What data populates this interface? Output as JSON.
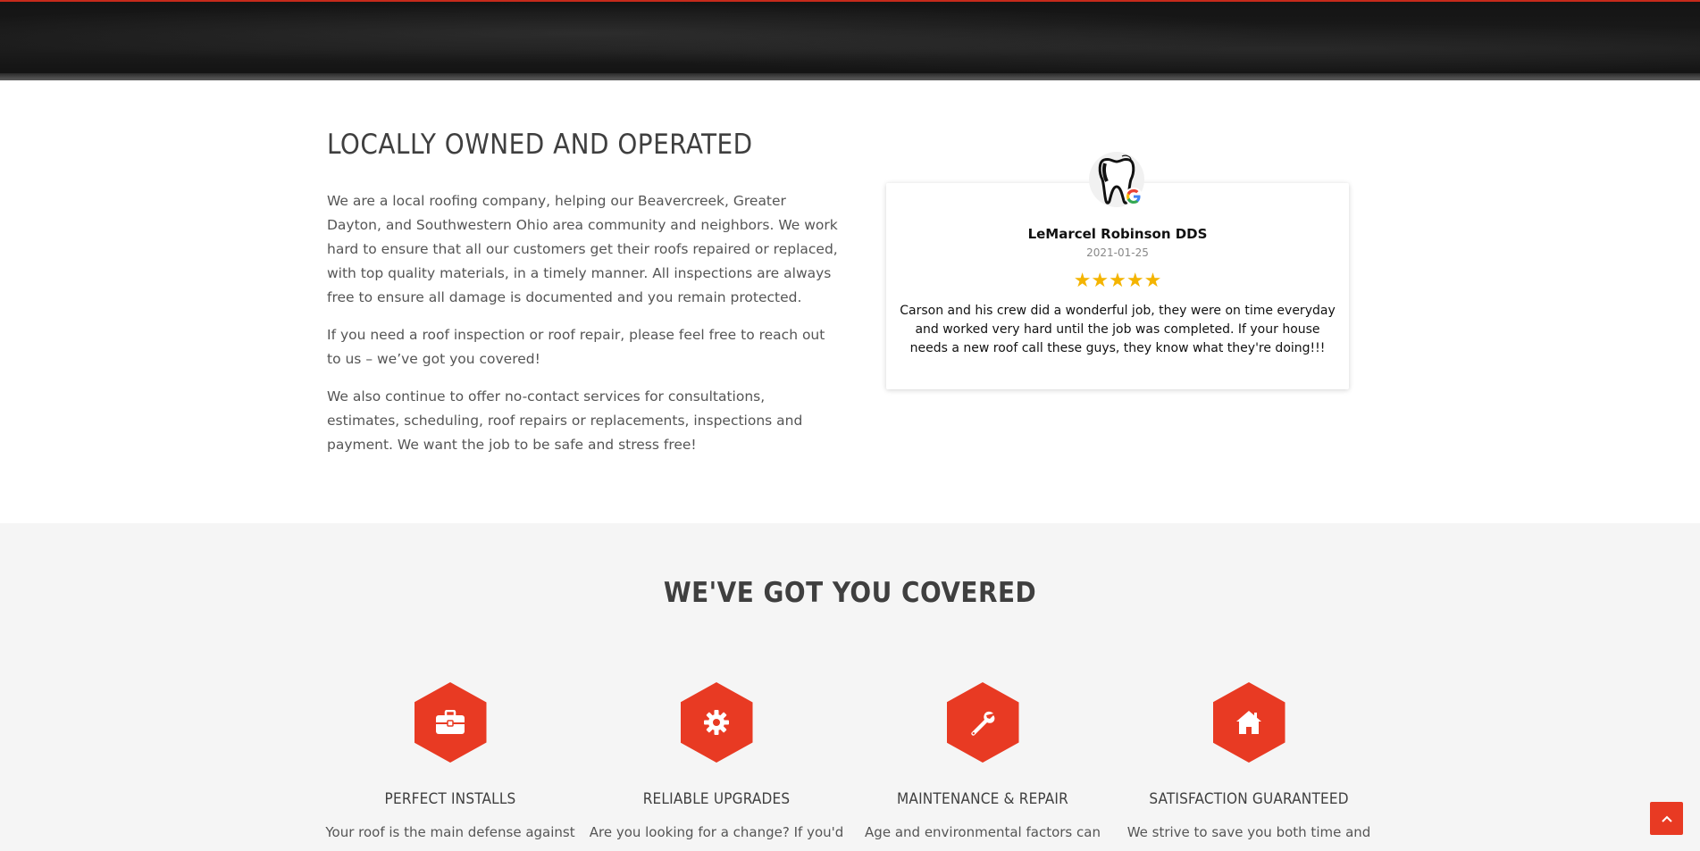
{
  "about": {
    "title": "LOCALLY OWNED AND OPERATED",
    "paragraphs": [
      "We are a local roofing company, helping our Beavercreek, Greater Dayton, and Southwestern Ohio area community and neighbors.  We work hard to ensure that all our customers get their roofs repaired or replaced, with top quality materials, in a timely manner.   All inspections are always free to ensure all damage is documented and you remain protected.",
      "If you need a roof inspection or roof repair, please feel free to reach out to us – we’ve got you covered!",
      "We also continue to offer no-contact services for consultations, estimates, scheduling, roof repairs or replacements, inspections and payment.  We want the job to be safe and stress free!"
    ]
  },
  "review": {
    "name": "LeMarcel Robinson DDS",
    "date": "2021-01-25",
    "stars": "★★★★★",
    "rating": 5,
    "text": "Carson and his crew did a wonderful job, they were on time everyday and worked very hard until the job was completed. If your house needs a new roof call these guys, they know what they're doing!!!",
    "avatar_icon": "tooth-icon",
    "source_icon": "google-icon"
  },
  "covered": {
    "title": "WE'VE GOT YOU COVERED",
    "features": [
      {
        "icon": "briefcase-icon",
        "title": "PERFECT INSTALLS",
        "text": "Your roof is the main defense against"
      },
      {
        "icon": "gear-icon",
        "title": "RELIABLE UPGRADES",
        "text": "Are you looking for a change? If you'd"
      },
      {
        "icon": "wrench-icon",
        "title": "MAINTENANCE & REPAIR",
        "text": "Age and environmental factors can"
      },
      {
        "icon": "home-icon",
        "title": "SATISFACTION GUARANTEED",
        "text": "We strive to save you both time and"
      }
    ]
  },
  "colors": {
    "accent": "#e83a23",
    "star": "#f4b400",
    "heading": "#3f3f3f",
    "section_bg": "#f5f5f5"
  },
  "back_to_top": {
    "icon": "chevron-up-icon"
  }
}
